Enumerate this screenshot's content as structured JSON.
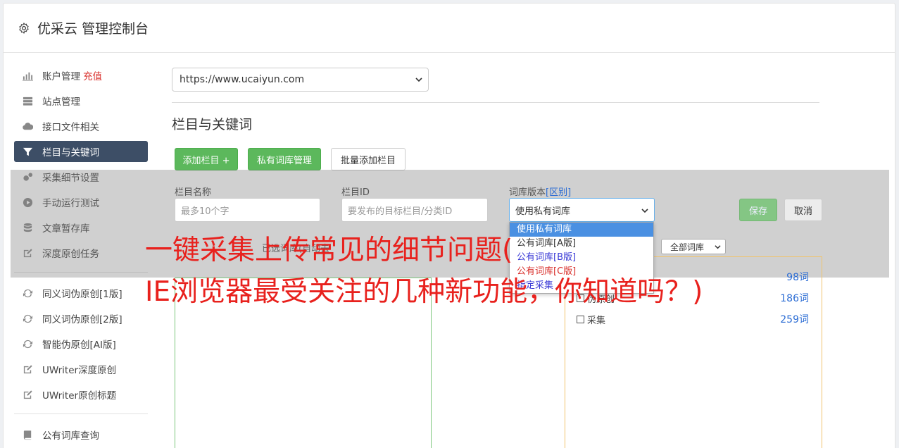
{
  "header": {
    "title": "优采云 管理控制台"
  },
  "sidebar": {
    "items": [
      {
        "label": "账户管理",
        "extra": "充值",
        "icon": "bar-chart-icon"
      },
      {
        "label": "站点管理",
        "icon": "server-icon"
      },
      {
        "label": "接口文件相关",
        "icon": "cloud-upload-icon"
      },
      {
        "label": "栏目与关键词",
        "icon": "filter-icon",
        "active": true
      },
      {
        "label": "采集细节设置",
        "icon": "gears-icon"
      },
      {
        "label": "手动运行测试",
        "icon": "play-icon"
      },
      {
        "label": "文章暂存库",
        "icon": "database-icon"
      },
      {
        "label": "深度原创任务",
        "icon": "edit-icon"
      }
    ],
    "items2": [
      {
        "label": "同义词伪原创[1版]",
        "icon": "refresh-icon"
      },
      {
        "label": "同义词伪原创[2版]",
        "icon": "refresh-icon"
      },
      {
        "label": "智能伪原创[AI版]",
        "icon": "refresh-icon"
      },
      {
        "label": "UWriter深度原创",
        "icon": "edit-icon"
      },
      {
        "label": "UWriter原创标题",
        "icon": "edit-icon"
      }
    ],
    "items3": [
      {
        "label": "公有词库查询",
        "icon": "book-icon"
      }
    ]
  },
  "main": {
    "site_select": "https://www.ucaiyun.com",
    "section_title": "栏目与关键词",
    "buttons": {
      "add_column": "添加栏目 +",
      "private_lib": "私有词库管理",
      "batch_add": "批量添加栏目"
    },
    "form": {
      "name_label": "栏目名称",
      "name_placeholder": "最多10个字",
      "id_label": "栏目ID",
      "id_placeholder": "要发布的目标栏目/分类ID",
      "version_label": "词库版本",
      "version_link": "[区别]",
      "version_value": "使用私有词库",
      "save": "保存",
      "cancel": "取消"
    },
    "dropdown_options": [
      "使用私有词库",
      "公有词库[A版]",
      "公有词库[B版]",
      "公有词库[C版]",
      "指定采集"
    ],
    "selected_hint": "已选词库(自动去",
    "filter_select": "全部词库",
    "libraries": [
      {
        "name": "",
        "count": "98词"
      },
      {
        "name": "伪原创",
        "count": "186词"
      },
      {
        "name": "采集",
        "count": "259词"
      }
    ]
  },
  "headline": {
    "line1": "一键采集上传常见的细节问题(",
    "line2": "IE浏览器最受关注的几种新功能，你知道吗？)"
  },
  "colors": {
    "accent_green": "#5cb85c",
    "active_nav": "#3d4e66",
    "headline_red": "#e8211d",
    "link_blue": "#2b6cd4"
  }
}
